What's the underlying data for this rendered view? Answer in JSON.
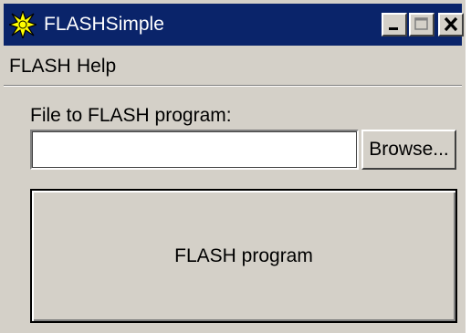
{
  "window": {
    "title": "FLASHSimple",
    "app_icon": "starburst-icon",
    "controls": {
      "minimize": "minimize-icon",
      "maximize": "maximize-icon",
      "close": "close-icon"
    }
  },
  "menu": {
    "items": [
      {
        "label": "FLASH"
      },
      {
        "label": "Help"
      }
    ]
  },
  "form": {
    "file_label": "File to FLASH program:",
    "file_value": "",
    "browse_label": "Browse...",
    "flash_button_label": "FLASH program"
  },
  "colors": {
    "titlebar": "#0a246a",
    "face": "#d4d0c8",
    "icon_star": "#ffff00"
  }
}
